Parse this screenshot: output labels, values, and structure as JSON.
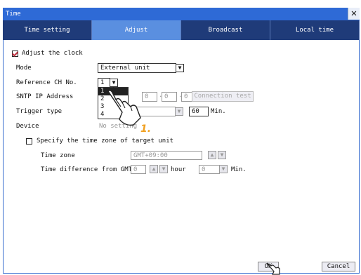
{
  "window": {
    "title": "Time",
    "close_glyph": "✕"
  },
  "tabs": [
    {
      "label": "Time setting",
      "active": false
    },
    {
      "label": "Adjust",
      "active": true
    },
    {
      "label": "Broadcast",
      "active": false
    },
    {
      "label": "Local time",
      "active": false
    }
  ],
  "adjust": {
    "label": "Adjust the clock",
    "checked": true,
    "mode_label": "Mode",
    "mode_value": "External unit",
    "ref_label": "Reference CH No.",
    "ref_value": "1",
    "sntp_label": "SNTP IP Address",
    "sntp_ip": [
      "0",
      "0",
      "0"
    ],
    "connection_test_label": "Connection test",
    "trigger_label": "Trigger type",
    "trigger_min_value": "60",
    "trigger_min_unit": "Min.",
    "device_label": "Device",
    "device_value": "No setting",
    "ref_options": [
      "1",
      "2",
      "3",
      "4"
    ]
  },
  "timezone": {
    "label": "Specify the time zone of target unit",
    "checked": false,
    "tz_label": "Time zone",
    "tz_value": "GMT+09:00",
    "diff_label": "Time difference from GMT",
    "hour_value": "0",
    "hour_unit": "hour",
    "min_value": "0",
    "min_unit": "Min."
  },
  "callout": "1.",
  "footer": {
    "ok_label": "OK",
    "cancel_label": "Cancel"
  },
  "colors": {
    "titlebar": "#2e6ad6",
    "tab_inactive": "#1f3b79",
    "tab_active": "#5a8fe0",
    "callout": "#f0a020"
  }
}
